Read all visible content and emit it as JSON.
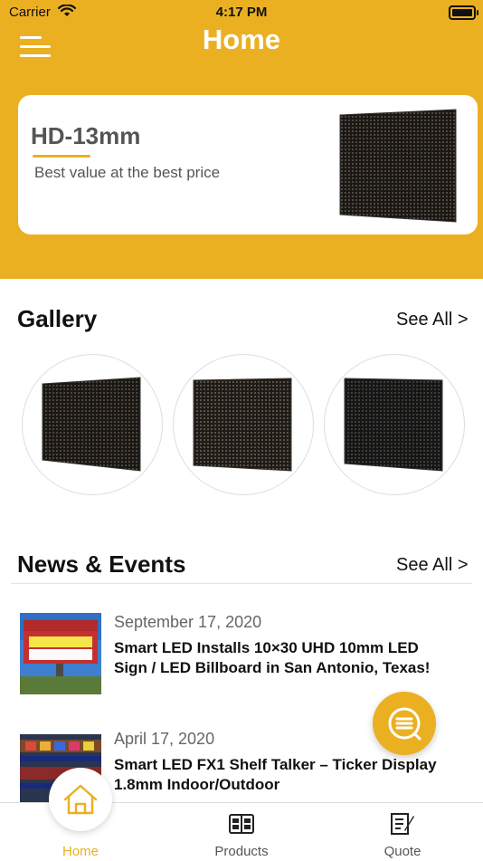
{
  "status_bar": {
    "carrier": "Carrier",
    "time": "4:17 PM"
  },
  "header": {
    "title": "Home"
  },
  "banner": {
    "title": "HD-13mm",
    "subtitle": "Best value at the best price"
  },
  "gallery": {
    "title": "Gallery",
    "see_all": "See All >"
  },
  "news": {
    "title": "News & Events",
    "see_all": "See All >",
    "items": [
      {
        "date": "September 17, 2020",
        "title": "Smart LED Installs 10×30 UHD 10mm LED Sign / LED Billboard in San Antonio,  Texas!"
      },
      {
        "date": "April 17, 2020",
        "title": "Smart LED FX1 Shelf Talker – Ticker Display 1.8mm Indoor/Outdoor"
      }
    ]
  },
  "tabs": [
    {
      "label": "Home",
      "icon": "home-icon"
    },
    {
      "label": "Products",
      "icon": "catalog-icon"
    },
    {
      "label": "Quote",
      "icon": "quote-icon"
    }
  ],
  "colors": {
    "accent": "#ebb022",
    "text": "#111111",
    "muted": "#666666"
  }
}
